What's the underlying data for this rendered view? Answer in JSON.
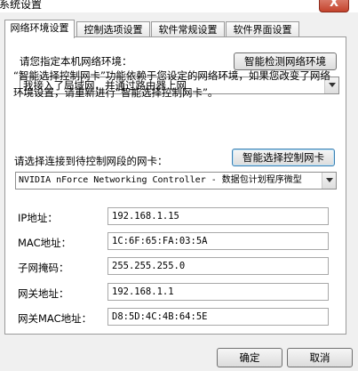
{
  "window": {
    "title": "系统设置",
    "close_label": "X"
  },
  "tabs": [
    {
      "label": "网络环境设置",
      "active": true
    },
    {
      "label": "控制选项设置",
      "active": false
    },
    {
      "label": "软件常规设置",
      "active": false
    },
    {
      "label": "软件界面设置",
      "active": false
    }
  ],
  "network": {
    "prompt_label": "请您指定本机网络环境：",
    "detect_button": "智能检测网络环境",
    "environment_value": "我接入了局域网，并通过路由器上网",
    "description": "“智能选择控制网卡”功能依赖于您设定的网络环境，如果您改变了网络环境设置，请重新进行“智能选择控制网卡”。",
    "nic_label": "请选择连接到待控制网段的网卡：",
    "select_nic_button": "智能选择控制网卡",
    "nic_value": "NVIDIA nForce Networking Controller - 数据包计划程序微型"
  },
  "fields": [
    {
      "label": "IP地址：",
      "value": "192.168.1.15"
    },
    {
      "label": "MAC地址：",
      "value": "1C:6F:65:FA:03:5A"
    },
    {
      "label": "子网掩码：",
      "value": "255.255.255.0"
    },
    {
      "label": "网关地址：",
      "value": "192.168.1.1"
    },
    {
      "label": "网关MAC地址：",
      "value": "D8:5D:4C:4B:64:5E"
    }
  ],
  "buttons": {
    "ok": "确定",
    "cancel": "取消"
  }
}
